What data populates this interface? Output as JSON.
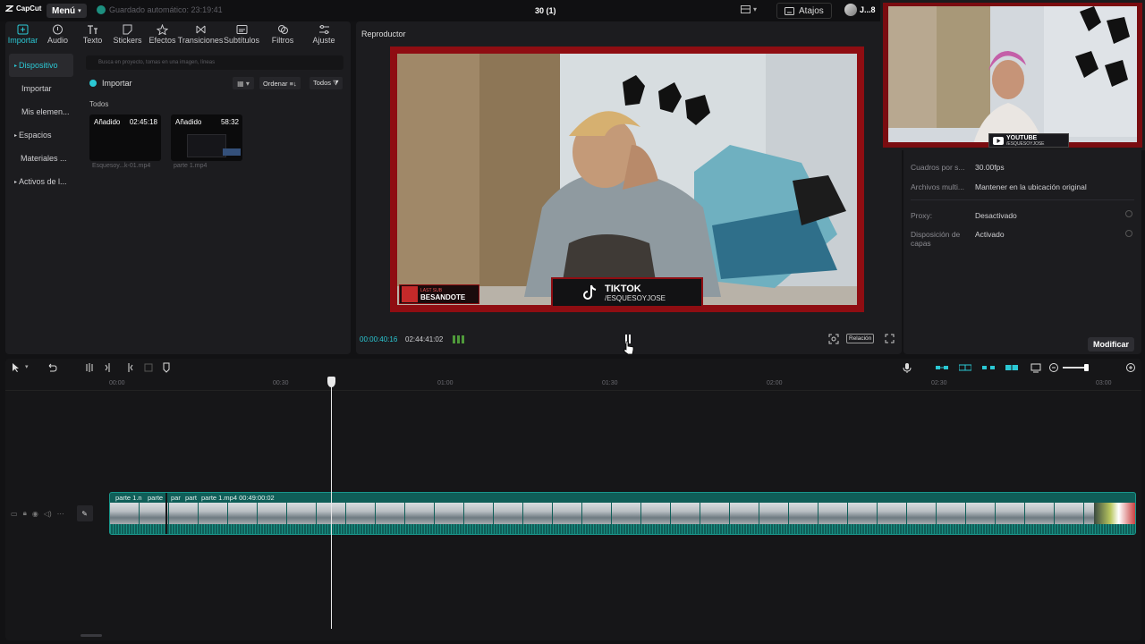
{
  "topbar": {
    "logo_text": "CapCut",
    "menu_label": "Menú",
    "autosave_text": "Guardado automático: 23:19:41",
    "project_title": "30 (1)",
    "shortcuts_label": "Atajos",
    "account_label": "J...8"
  },
  "tools": [
    {
      "label": "Importar",
      "icon": "import-icon"
    },
    {
      "label": "Audio",
      "icon": "audio-icon"
    },
    {
      "label": "Texto",
      "icon": "text-icon"
    },
    {
      "label": "Stickers",
      "icon": "sticker-icon"
    },
    {
      "label": "Efectos",
      "icon": "effects-icon"
    },
    {
      "label": "Transiciones",
      "icon": "transition-icon"
    },
    {
      "label": "Subtítulos",
      "icon": "subtitles-icon"
    },
    {
      "label": "Filtros",
      "icon": "filters-icon"
    },
    {
      "label": "Ajuste",
      "icon": "adjust-icon"
    }
  ],
  "left_nav": [
    {
      "label": "Dispositivo",
      "caret": "▸"
    },
    {
      "label": "Importar",
      "caret": ""
    },
    {
      "label": "Mis elemen...",
      "caret": ""
    },
    {
      "label": "Espacios",
      "caret": "▸"
    },
    {
      "label": "Materiales ...",
      "caret": ""
    },
    {
      "label": "Activos de l...",
      "caret": "▸"
    }
  ],
  "media": {
    "search_placeholder": "Busca en proyecto, tomas en una imagen, líneas",
    "import_label": "Importar",
    "order_label": "Ordenar ≡↓",
    "all_label": "Todos ⧩",
    "section_label": "Todos",
    "items": [
      {
        "tag": "Añadido",
        "duration": "02:45:18",
        "name": "Esquesoy...k-01.mp4"
      },
      {
        "tag": "Añadido",
        "duration": "58:32",
        "name": "parte 1.mp4"
      }
    ]
  },
  "player": {
    "title": "Reproductor",
    "current_time": "00:00:40:16",
    "total_time": "02:44:41:02",
    "ratio_label": "Relación",
    "overlay_tiktok": "TIKTOK",
    "overlay_handle": "/ESQUESOYJOSE",
    "overlay_alert_small": "LAST SUB",
    "overlay_alert": "BESANDOTE"
  },
  "properties": {
    "rows": [
      {
        "label": "Cuadros por s...",
        "value": "30.00fps"
      },
      {
        "label": "Archivos multi...",
        "value": "Mantener en la ubicación original"
      },
      {
        "label": "Proxy:",
        "value": "Desactivado"
      },
      {
        "label": "Disposición de capas",
        "value": "Activado"
      }
    ],
    "modify_label": "Modificar"
  },
  "webcam": {
    "badge_title": "YOUTUBE",
    "badge_handle": "/ESQUESOYJOSE"
  },
  "timeline": {
    "ticks": [
      "00:00",
      "00:30",
      "01:00",
      "01:30",
      "02:00",
      "02:30",
      "03:00"
    ],
    "clip_segments": [
      "parte 1.n",
      "parte",
      "par",
      "part",
      "parte 1.mp4  00:49:00:02"
    ]
  },
  "colors": {
    "accent": "#2bc8d4",
    "clip": "#0f5e58",
    "frame_red": "#8f0d12"
  }
}
